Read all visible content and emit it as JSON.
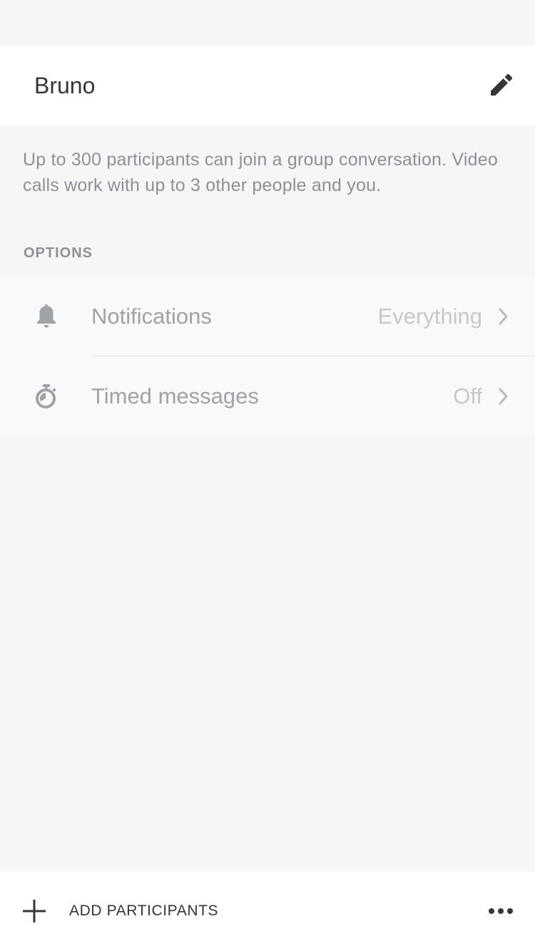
{
  "conversation": {
    "name": "Bruno"
  },
  "info": {
    "text": "Up to 300 participants can join a group conversation. Video calls work with up to 3 other people and you."
  },
  "options": {
    "header": "OPTIONS",
    "items": [
      {
        "label": "Notifications",
        "value": "Everything",
        "icon": "bell-icon"
      },
      {
        "label": "Timed messages",
        "value": "Off",
        "icon": "timer-icon"
      }
    ]
  },
  "footer": {
    "add_label": "ADD PARTICIPANTS",
    "add_icon": "plus-icon",
    "more_icon": "more-icon"
  },
  "colors": {
    "background": "#f6f6f6",
    "surface": "#ffffff",
    "primary_text": "#33373a",
    "secondary_text": "#8c9197",
    "disabled_text": "#9fa3a7"
  }
}
